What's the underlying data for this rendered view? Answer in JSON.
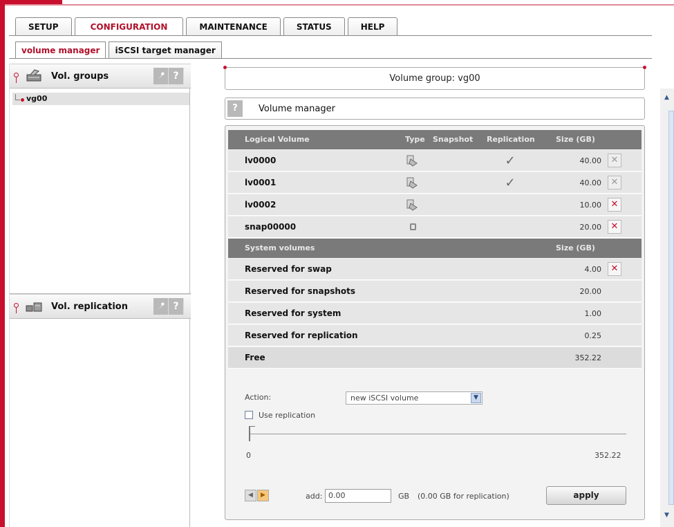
{
  "main_tabs": [
    {
      "label": "SETUP"
    },
    {
      "label": "CONFIGURATION"
    },
    {
      "label": "MAINTENANCE"
    },
    {
      "label": "STATUS"
    },
    {
      "label": "HELP"
    }
  ],
  "sub_tabs": [
    {
      "label": "volume manager"
    },
    {
      "label": "iSCSI target manager"
    }
  ],
  "left": {
    "vol_groups": {
      "title": "Vol. groups",
      "tool_icon": "wrench-icon",
      "help": "?"
    },
    "groups": [
      {
        "label": "vg00"
      }
    ],
    "vol_replication": {
      "title": "Vol. replication",
      "tool_icon": "wrench-icon",
      "help": "?"
    }
  },
  "volume_group_header": "Volume group: vg00",
  "volume_manager": {
    "help": "?",
    "title": "Volume manager",
    "columns": {
      "logical_volume": "Logical Volume",
      "type": "Type",
      "snapshot": "Snapshot",
      "replication": "Replication",
      "size": "Size (GB)"
    },
    "logical_volumes": [
      {
        "name": "lv0000",
        "type": "iscsi-volume-icon",
        "replication": "✓",
        "size": "40.00",
        "delete_enabled": false
      },
      {
        "name": "lv0001",
        "type": "iscsi-volume-icon",
        "replication": "✓",
        "size": "40.00",
        "delete_enabled": false
      },
      {
        "name": "lv0002",
        "type": "iscsi-volume-icon",
        "replication": "",
        "size": "10.00",
        "delete_enabled": true
      },
      {
        "name": "snap00000",
        "type": "snapshot-icon",
        "replication": "",
        "size": "20.00",
        "delete_enabled": true
      }
    ],
    "system_columns": {
      "name": "System volumes",
      "size": "Size (GB)"
    },
    "system_volumes": [
      {
        "name": "Reserved for swap",
        "size": "4.00"
      },
      {
        "name": "Reserved for snapshots",
        "size": "20.00"
      },
      {
        "name": "Reserved for system",
        "size": "1.00"
      },
      {
        "name": "Reserved for replication",
        "size": "0.25"
      },
      {
        "name": "Free",
        "size": "352.22"
      }
    ],
    "delete_symbol": "✕",
    "action": {
      "label": "Action:",
      "selected": "new iSCSI volume",
      "use_replication_label": "Use replication",
      "use_replication_checked": false,
      "slider_min": "0",
      "slider_max": "352.22",
      "slider_value": 0,
      "add_label": "add:",
      "add_value": "0.00",
      "unit": "GB",
      "replication_note": "(0.00 GB for replication)",
      "apply_label": "apply"
    }
  },
  "colors": {
    "brand_red": "#c8102e",
    "header_gray": "#7a7a7a"
  }
}
